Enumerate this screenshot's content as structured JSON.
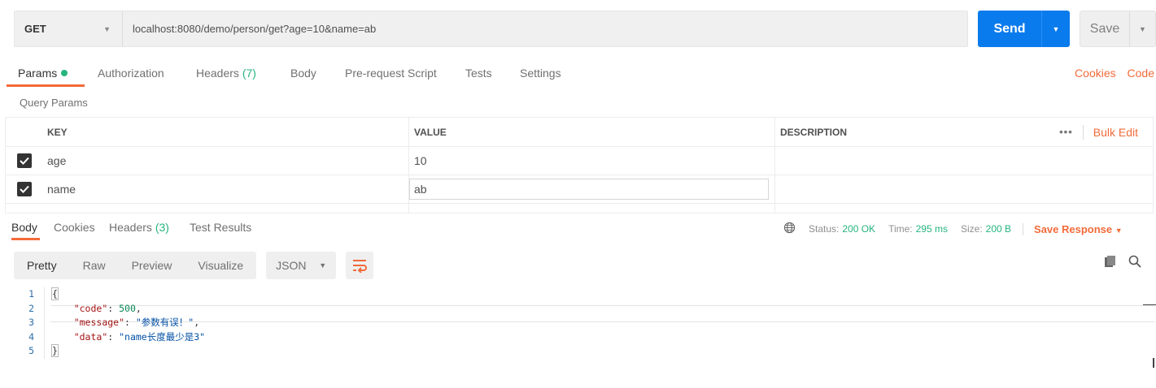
{
  "request": {
    "method": "GET",
    "url": "localhost:8080/demo/person/get?age=10&name=ab",
    "send_label": "Send",
    "save_label": "Save"
  },
  "request_tabs": {
    "params": "Params",
    "authorization": "Authorization",
    "headers": "Headers",
    "headers_count": "(7)",
    "body": "Body",
    "prerequest": "Pre-request Script",
    "tests": "Tests",
    "settings": "Settings",
    "cookies": "Cookies",
    "code": "Code"
  },
  "params_section": {
    "title": "Query Params",
    "columns": {
      "key": "KEY",
      "value": "VALUE",
      "description": "DESCRIPTION"
    },
    "dots": "•••",
    "bulk_edit": "Bulk Edit",
    "rows": [
      {
        "key": "age",
        "value": "10",
        "description": "",
        "checked": true
      },
      {
        "key": "name",
        "value": "ab",
        "description": "",
        "checked": true
      }
    ]
  },
  "response_tabs": {
    "body": "Body",
    "cookies": "Cookies",
    "headers": "Headers",
    "headers_count": "(3)",
    "test_results": "Test Results"
  },
  "response_status": {
    "status_label": "Status:",
    "status_value": "200 OK",
    "time_label": "Time:",
    "time_value": "295 ms",
    "size_label": "Size:",
    "size_value": "200 B",
    "save_response": "Save Response"
  },
  "response_toolbar": {
    "views": [
      "Pretty",
      "Raw",
      "Preview",
      "Visualize"
    ],
    "format": "JSON"
  },
  "response_body": {
    "line_numbers": [
      "1",
      "2",
      "3",
      "4",
      "5"
    ],
    "open_brace": "{",
    "close_brace": "}",
    "fields": [
      {
        "key": "\"code\"",
        "value": "500",
        "suffix": ","
      },
      {
        "key": "\"message\"",
        "value": "\"参数有误！\"",
        "suffix": ","
      },
      {
        "key": "\"data\"",
        "value": "\"name长度最少是3\"",
        "suffix": ""
      }
    ]
  },
  "colors": {
    "accent": "#f26b3a",
    "send": "#097bed",
    "success": "#26b47f"
  }
}
